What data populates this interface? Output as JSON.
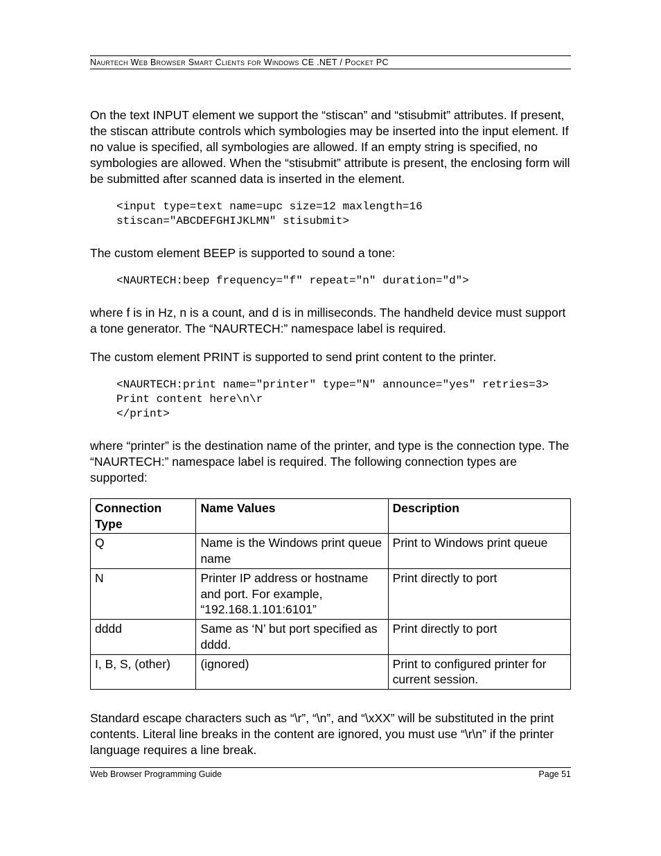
{
  "header": "Naurtech Web Browser Smart Clients for Windows CE .NET / Pocket PC",
  "p1": "On the text INPUT element we support the “stiscan” and “stisubmit” attributes.  If present, the stiscan attribute controls which symbologies may be inserted into the input element.  If no value is specified, all symbologies are allowed.  If an empty string is specified, no symbologies are allowed.  When the “stisubmit” attribute is present, the enclosing form will be submitted after scanned data is inserted in the element.",
  "code1": "<input type=text name=upc size=12 maxlength=16\nstiscan=\"ABCDEFGHIJKLMN\" stisubmit>",
  "p2": "The custom element BEEP is supported to sound a tone:",
  "code2": "<NAURTECH:beep frequency=\"f\" repeat=\"n\" duration=\"d\">",
  "p3": "where f is in Hz, n is a count, and d is in milliseconds.  The handheld device must support a tone generator.  The “NAURTECH:” namespace label is required.",
  "p4": "The custom element PRINT is supported to send print content to the printer.",
  "code3": "<NAURTECH:print name=\"printer\" type=\"N\" announce=\"yes\" retries=3>\nPrint content here\\n\\r\n</print>",
  "p5": "where “printer” is the destination name of the printer, and type is the connection type.  The “NAURTECH:” namespace label is required.  The following connection types are supported:",
  "table": {
    "headers": [
      "Connection Type",
      "Name Values",
      "Description"
    ],
    "rows": [
      [
        "Q",
        "Name is the Windows print queue name",
        "Print to Windows print queue"
      ],
      [
        "N",
        "Printer IP address or hostname and port.  For example, “192.168.1.101:6101”",
        "Print directly to port"
      ],
      [
        "dddd",
        "Same as ‘N’ but port specified as dddd.",
        "Print directly to port"
      ],
      [
        "I, B, S, (other)",
        "(ignored)",
        "Print to configured printer for current session."
      ]
    ]
  },
  "p6": "Standard escape characters such as “\\r”, “\\n”, and “\\xXX” will be substituted in the print contents.  Literal line breaks in the content are ignored, you must use “\\r\\n” if the printer language requires a line break.",
  "footer_left": "Web Browser Programming Guide",
  "footer_right": "Page 51"
}
